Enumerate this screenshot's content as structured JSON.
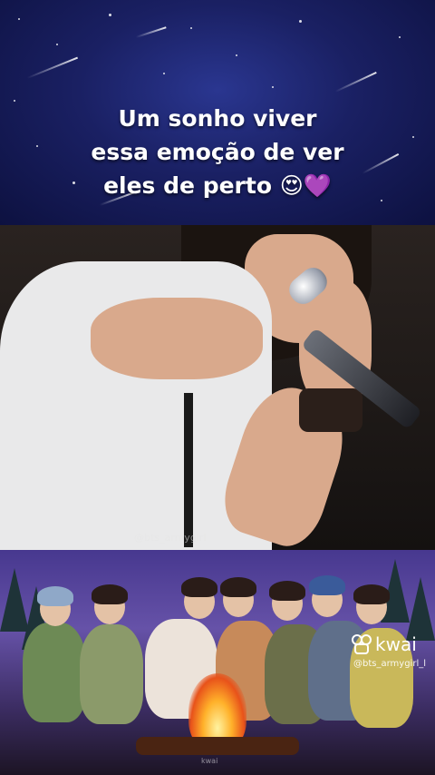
{
  "caption": {
    "line1": "Um sonho viver",
    "line2": "essa emoção de ver",
    "line3": "eles de perto 😍💜"
  },
  "video": {
    "watermark": "@bts_armygirl"
  },
  "kwai": {
    "brand": "kwai",
    "handle": "@bts_armygirl_l"
  },
  "bottom_watermark": "kwai",
  "colors": {
    "top_bg": "#1a2063",
    "bottom_bg": "#6652a8",
    "caption_text": "#ffffff"
  }
}
